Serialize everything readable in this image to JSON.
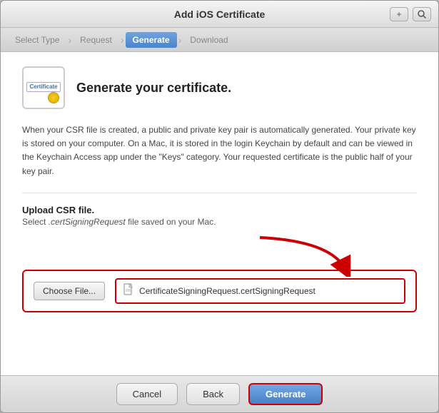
{
  "window": {
    "title": "Add iOS Certificate"
  },
  "title_bar": {
    "plus_btn": "+",
    "search_btn": "🔍"
  },
  "steps": [
    {
      "id": "select-type",
      "label": "Select Type",
      "state": "inactive"
    },
    {
      "id": "request",
      "label": "Request",
      "state": "inactive"
    },
    {
      "id": "generate",
      "label": "Generate",
      "state": "active"
    },
    {
      "id": "download",
      "label": "Download",
      "state": "inactive"
    }
  ],
  "content": {
    "title": "Generate your certificate.",
    "description": "When your CSR file is created, a public and private key pair is automatically generated. Your private key is stored on your computer. On a Mac, it is stored in the login Keychain by default and can be viewed in the Keychain Access app under the \"Keys\" category. Your requested certificate is the public half of your key pair.",
    "upload_label": "Upload CSR file.",
    "upload_sublabel_prefix": "Select ",
    "upload_sublabel_file": ".certSigningRequest",
    "upload_sublabel_suffix": " file saved on your Mac.",
    "choose_btn_label": "Choose File...",
    "file_name": "CertificateSigningRequest.certSigningRequest"
  },
  "footer": {
    "cancel_label": "Cancel",
    "back_label": "Back",
    "generate_label": "Generate"
  }
}
